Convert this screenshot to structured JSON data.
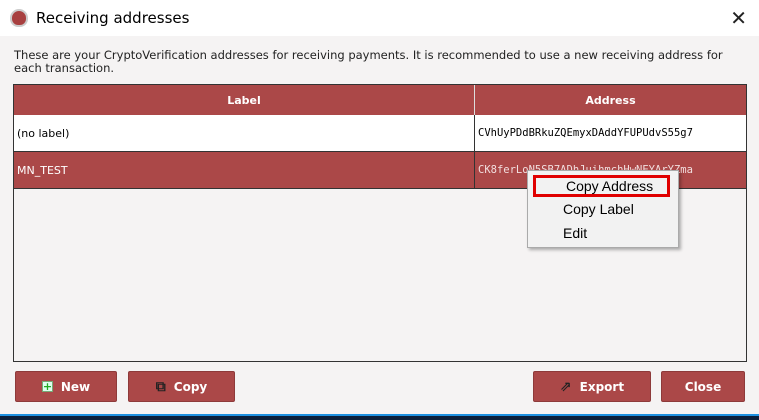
{
  "window": {
    "title": "Receiving addresses",
    "icon": "shield-logo-icon",
    "close_icon": "close-icon"
  },
  "description": "These are your CryptoVerification addresses for receiving payments. It is recommended to use a new receiving address for each transaction.",
  "table": {
    "columns": [
      "Label",
      "Address"
    ],
    "rows": [
      {
        "label": "(no label)",
        "address": "CVhUyPDdBRkuZQEmyxDAddYFUPUdvS55g7"
      },
      {
        "label": "MN_TEST",
        "address": "CK8ferLoN5SB7ADhJuihmchHwNEYArYZma",
        "selected": true
      }
    ]
  },
  "context_menu": {
    "items": [
      "Copy Address",
      "Copy Label",
      "Edit"
    ],
    "highlighted": "Copy Address"
  },
  "buttons": {
    "new": "New",
    "copy": "Copy",
    "export": "Export",
    "close": "Close"
  },
  "colors": {
    "accent": "#ab4848",
    "highlight_border": "#e00000"
  }
}
